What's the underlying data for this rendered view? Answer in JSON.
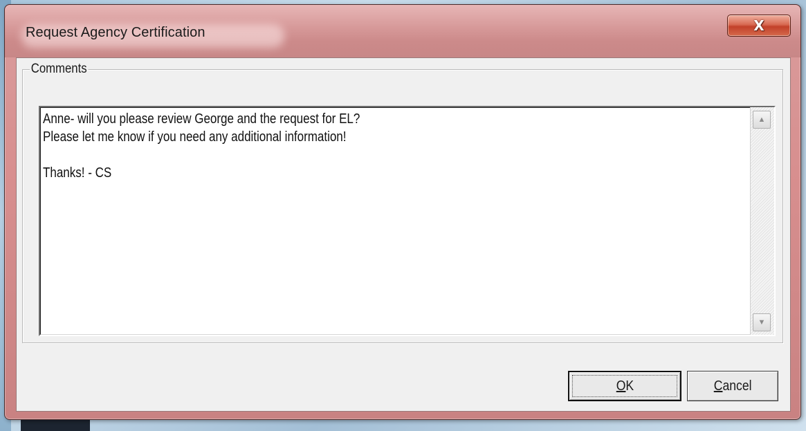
{
  "window": {
    "title": "Request Agency Certification",
    "close_label": "X"
  },
  "comments": {
    "label": "Comments",
    "text": "Anne- will you please review George and the request for EL?\nPlease let me know if you need any additional information!\n\nThanks! - CS"
  },
  "scrollbar": {
    "up_glyph": "▲",
    "down_glyph": "▼"
  },
  "buttons": {
    "ok_mnemonic": "O",
    "ok_rest": "K",
    "cancel_mnemonic": "C",
    "cancel_rest": "ancel"
  },
  "colors": {
    "title_bar": "#d69898",
    "close_button": "#c2412a",
    "dialog_face": "#f0f0f0"
  }
}
